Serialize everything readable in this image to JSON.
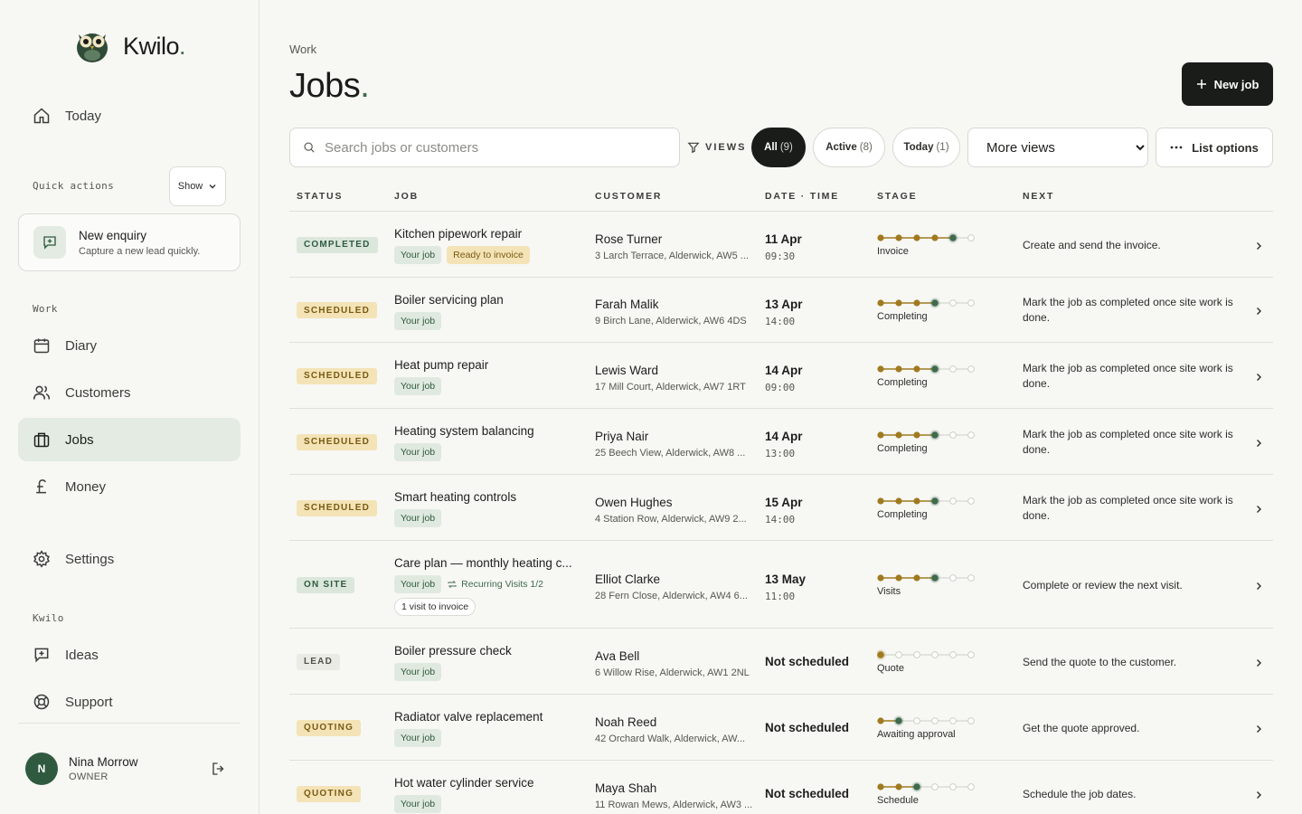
{
  "brand": {
    "name": "Kwilo",
    "dot": "."
  },
  "nav": {
    "today": "Today",
    "quick_actions_label": "Quick actions",
    "show_label": "Show",
    "quick_action": {
      "title": "New enquiry",
      "subtitle": "Capture a new lead quickly."
    },
    "work_label": "Work",
    "diary": "Diary",
    "customers": "Customers",
    "jobs": "Jobs",
    "money": "Money",
    "settings": "Settings",
    "kwilo_label": "Kwilo",
    "ideas": "Ideas",
    "support": "Support"
  },
  "user": {
    "initial": "N",
    "name": "Nina Morrow",
    "role": "OWNER"
  },
  "header": {
    "breadcrumb": "Work",
    "title": "Jobs",
    "title_dot": ".",
    "new_job": "New job"
  },
  "toolbar": {
    "search_placeholder": "Search jobs or customers",
    "views_label": "VIEWS",
    "pills": [
      {
        "label": "All",
        "count": "(9)",
        "active": true
      },
      {
        "label": "Active",
        "count": "(8)",
        "active": false
      },
      {
        "label": "Today",
        "count": "(1)",
        "active": false
      }
    ],
    "more_views": "More views",
    "list_options": "List options"
  },
  "columns": {
    "status": "STATUS",
    "job": "JOB",
    "customer": "CUSTOMER",
    "datetime": "DATE · TIME",
    "stage": "STAGE",
    "next": "NEXT"
  },
  "colors": {
    "accent": "#3f6b4c",
    "stage_done": "#a07a1e",
    "stage_current": "#3f6b4c",
    "stage_todo": "#cfcfc9"
  },
  "rows": [
    {
      "status": "COMPLETED",
      "status_kind": "completed",
      "job": "Kitchen pipework repair",
      "tags": [
        "Your job",
        "Ready to invoice"
      ],
      "customer": "Rose Turner",
      "address": "3 Larch Terrace, Alderwick, AW5 ...",
      "date": "11 Apr",
      "time": "09:30",
      "stage_label": "Invoice",
      "stage_done": 4,
      "stage_current": 5,
      "next": "Create and send the invoice."
    },
    {
      "status": "SCHEDULED",
      "status_kind": "scheduled",
      "job": "Boiler servicing plan",
      "tags": [
        "Your job"
      ],
      "customer": "Farah Malik",
      "address": "9 Birch Lane, Alderwick, AW6 4DS",
      "date": "13 Apr",
      "time": "14:00",
      "stage_label": "Completing",
      "stage_done": 3,
      "stage_current": 4,
      "next": "Mark the job as completed once site work is done."
    },
    {
      "status": "SCHEDULED",
      "status_kind": "scheduled",
      "job": "Heat pump repair",
      "tags": [
        "Your job"
      ],
      "customer": "Lewis Ward",
      "address": "17 Mill Court, Alderwick, AW7 1RT",
      "date": "14 Apr",
      "time": "09:00",
      "stage_label": "Completing",
      "stage_done": 3,
      "stage_current": 4,
      "next": "Mark the job as completed once site work is done."
    },
    {
      "status": "SCHEDULED",
      "status_kind": "scheduled",
      "job": "Heating system balancing",
      "tags": [
        "Your job"
      ],
      "customer": "Priya Nair",
      "address": "25 Beech View, Alderwick, AW8 ...",
      "date": "14 Apr",
      "time": "13:00",
      "stage_label": "Completing",
      "stage_done": 3,
      "stage_current": 4,
      "next": "Mark the job as completed once site work is done."
    },
    {
      "status": "SCHEDULED",
      "status_kind": "scheduled",
      "job": "Smart heating controls",
      "tags": [
        "Your job"
      ],
      "customer": "Owen Hughes",
      "address": "4 Station Row, Alderwick, AW9 2...",
      "date": "15 Apr",
      "time": "14:00",
      "stage_label": "Completing",
      "stage_done": 3,
      "stage_current": 4,
      "next": "Mark the job as completed once site work is done."
    },
    {
      "status": "ON SITE",
      "status_kind": "onsite",
      "job": "Care plan — monthly heating c...",
      "tags": [
        "Your job"
      ],
      "recurring": "Recurring Visits 1/2",
      "visit_tag": "1 visit to invoice",
      "customer": "Elliot Clarke",
      "address": "28 Fern Close, Alderwick, AW4 6...",
      "date": "13 May",
      "time": "11:00",
      "stage_label": "Visits",
      "stage_done": 3,
      "stage_current": 4,
      "next": "Complete or review the next visit."
    },
    {
      "status": "LEAD",
      "status_kind": "lead",
      "job": "Boiler pressure check",
      "tags": [
        "Your job"
      ],
      "customer": "Ava Bell",
      "address": "6 Willow Rise, Alderwick, AW1 2NL",
      "date": "Not scheduled",
      "time": "",
      "stage_label": "Quote",
      "stage_done": 0,
      "stage_current": 1,
      "next": "Send the quote to the customer."
    },
    {
      "status": "QUOTING",
      "status_kind": "quoting",
      "job": "Radiator valve replacement",
      "tags": [
        "Your job"
      ],
      "customer": "Noah Reed",
      "address": "42 Orchard Walk, Alderwick, AW...",
      "date": "Not scheduled",
      "time": "",
      "stage_label": "Awaiting approval",
      "stage_done": 1,
      "stage_current": 2,
      "next": "Get the quote approved."
    },
    {
      "status": "QUOTING",
      "status_kind": "quoting",
      "job": "Hot water cylinder service",
      "tags": [
        "Your job"
      ],
      "customer": "Maya Shah",
      "address": "11 Rowan Mews, Alderwick, AW3 ...",
      "date": "Not scheduled",
      "time": "",
      "stage_label": "Schedule",
      "stage_done": 2,
      "stage_current": 3,
      "next": "Schedule the job dates."
    }
  ]
}
